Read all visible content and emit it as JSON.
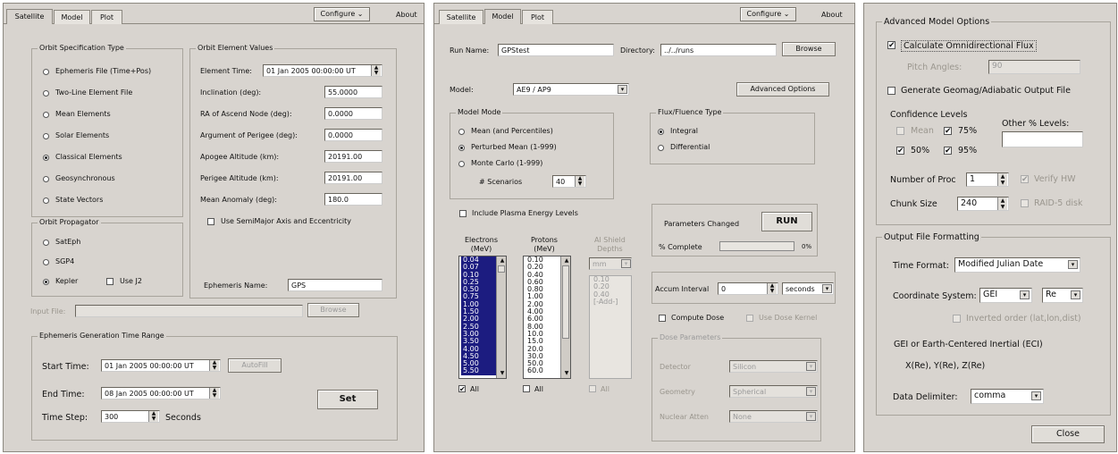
{
  "win1": {
    "tabs": [
      "Satellite",
      "Model",
      "Plot"
    ],
    "configure": "Configure",
    "about": "About",
    "orbit_spec": {
      "legend": "Orbit Specification Type",
      "options": [
        "Ephemeris File (Time+Pos)",
        "Two-Line Element File",
        "Mean Elements",
        "Solar Elements",
        "Classical Elements",
        "Geosynchronous",
        "State Vectors"
      ],
      "selected": "Classical Elements"
    },
    "orbit_elem": {
      "legend": "Orbit Element Values",
      "element_time_label": "Element Time:",
      "element_time": "01 Jan 2005 00:00:00 UT",
      "rows": [
        {
          "label": "Inclination (deg):",
          "value": "55.0000"
        },
        {
          "label": "RA of Ascend Node (deg):",
          "value": "0.0000"
        },
        {
          "label": "Argument of Perigee (deg):",
          "value": "0.0000"
        },
        {
          "label": "Apogee Altitude (km):",
          "value": "20191.00"
        },
        {
          "label": "Perigee Altitude (km):",
          "value": "20191.00"
        },
        {
          "label": "Mean Anomaly (deg):",
          "value": "180.0"
        }
      ],
      "use_semimajor": "Use SemiMajor Axis and Eccentricity",
      "eph_name_label": "Ephemeris Name:",
      "eph_name": "GPS"
    },
    "propagator": {
      "legend": "Orbit Propagator",
      "options": [
        "SatEph",
        "SGP4",
        "Kepler"
      ],
      "selected": "Kepler",
      "use_j2": "Use J2"
    },
    "input_file_label": "Input File:",
    "browse": "Browse",
    "time_range": {
      "legend": "Ephemeris Generation Time Range",
      "start_label": "Start Time:",
      "start": "01 Jan 2005 00:00:00 UT",
      "autofill": "AutoFill",
      "end_label": "End Time:",
      "end": "08 Jan 2005 00:00:00 UT",
      "step_label": "Time Step:",
      "step": "300",
      "step_unit": "Seconds",
      "set": "Set"
    }
  },
  "win2": {
    "tabs": [
      "Satellite",
      "Model",
      "Plot"
    ],
    "configure": "Configure",
    "about": "About",
    "run_name_label": "Run Name:",
    "run_name": "GPStest",
    "directory_label": "Directory:",
    "directory": "../../runs",
    "browse": "Browse",
    "model_label": "Model:",
    "model": "AE9 / AP9",
    "advanced": "Advanced Options",
    "model_mode": {
      "legend": "Model Mode",
      "options": [
        "Mean (and Percentiles)",
        "Perturbed Mean (1-999)",
        "Monte Carlo (1-999)"
      ],
      "selected": "Perturbed Mean (1-999)",
      "scenarios_label": "# Scenarios",
      "scenarios": "40"
    },
    "plasma": "Include Plasma Energy Levels",
    "flux_type": {
      "legend": "Flux/Fluence Type",
      "options": [
        "Integral",
        "Differential"
      ],
      "selected": "Integral"
    },
    "params_changed": "Parameters Changed",
    "run": "RUN",
    "complete_label": "% Complete",
    "complete": "0%",
    "electrons_header": "Electrons\n(MeV)",
    "protons_header": "Protons\n(MeV)",
    "shield_header": "Al Shield\nDepths",
    "electrons": [
      "0.04",
      "0.07",
      "0.10",
      "0.25",
      "0.50",
      "0.75",
      "1.00",
      "1.50",
      "2.00",
      "2.50",
      "3.00",
      "3.50",
      "4.00",
      "4.50",
      "5.00",
      "5.50"
    ],
    "protons": [
      "0.10",
      "0.20",
      "0.40",
      "0.60",
      "0.80",
      "1.00",
      "2.00",
      "4.00",
      "6.00",
      "8.00",
      "10.0",
      "15.0",
      "20.0",
      "30.0",
      "50.0",
      "60.0"
    ],
    "shield_unit": "mm",
    "shield": [
      "0.10",
      "0.20",
      "0.40",
      "[-Add-]"
    ],
    "all": "All",
    "accum_label": "Accum Interval",
    "accum": "0",
    "accum_unit": "seconds",
    "compute_dose": "Compute Dose",
    "use_dose_kernel": "Use Dose Kernel",
    "dose": {
      "legend": "Dose Parameters",
      "detector_label": "Detector",
      "detector": "Silicon",
      "geometry_label": "Geometry",
      "geometry": "Spherical",
      "nuclear_label": "Nuclear Atten",
      "nuclear": "None"
    }
  },
  "win3": {
    "adv": {
      "legend": "Advanced Model Options",
      "omni": "Calculate Omnidirectional Flux",
      "pitch_label": "Pitch Angles:",
      "pitch": "90",
      "geomag": "Generate Geomag/Adiabatic Output File",
      "conf_label": "Confidence Levels",
      "mean": "Mean",
      "p75": "75%",
      "p50": "50%",
      "p95": "95%",
      "other_label": "Other % Levels:",
      "other": "",
      "nproc_label": "Number of Proc",
      "nproc": "1",
      "verify": "Verify HW",
      "chunk_label": "Chunk Size",
      "chunk": "240",
      "raid": "RAID-5 disk"
    },
    "out": {
      "legend": "Output File Formatting",
      "time_format_label": "Time Format:",
      "time_format": "Modified Julian Date",
      "coord_label": "Coordinate System:",
      "coord": "GEI",
      "unit": "Re",
      "inverted": "Inverted order (lat,lon,dist)",
      "desc1": "GEI or Earth-Centered Inertial (ECI)",
      "desc2": "X(Re), Y(Re), Z(Re)",
      "delim_label": "Data Delimiter:",
      "delim": "comma"
    },
    "close": "Close"
  }
}
